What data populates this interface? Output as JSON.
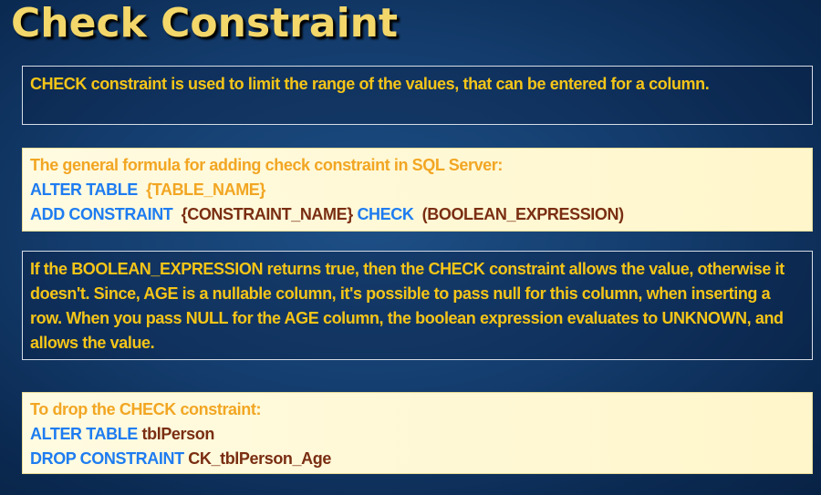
{
  "slide": {
    "title": "Check Constraint"
  },
  "definition": {
    "text": "CHECK constraint is used to limit the range of the values, that can be entered for a column."
  },
  "formula": {
    "heading": "The general formula for adding check constraint in SQL Server:",
    "line1_keyword": "ALTER TABLE",
    "line1_arg": "{TABLE_NAME}",
    "line2_keyword": "ADD CONSTRAINT",
    "line2_arg": "{CONSTRAINT_NAME}",
    "line2_keyword2": "CHECK",
    "line2_arg2": "(BOOLEAN_EXPRESSION)"
  },
  "explanation": {
    "text": "If the BOOLEAN_EXPRESSION returns true, then the CHECK constraint allows the value, otherwise it doesn't. Since, AGE is a nullable column, it's possible to pass null for this column, when inserting a row. When you pass NULL for the AGE column, the boolean expression evaluates to UNKNOWN, and allows the value."
  },
  "drop": {
    "heading": "To drop the CHECK constraint:",
    "line1_keyword": "ALTER TABLE",
    "line1_arg": "tblPerson",
    "line2_keyword": "DROP CONSTRAINT",
    "line2_arg": "CK_tblPerson_Age"
  },
  "colors": {
    "title": "#f3d76a",
    "yellow_text": "#f5c518",
    "orange_text": "#f2a623",
    "keyword_blue": "#1e7cf0",
    "arg_brown": "#7a2e12",
    "background": "#143d6e"
  }
}
